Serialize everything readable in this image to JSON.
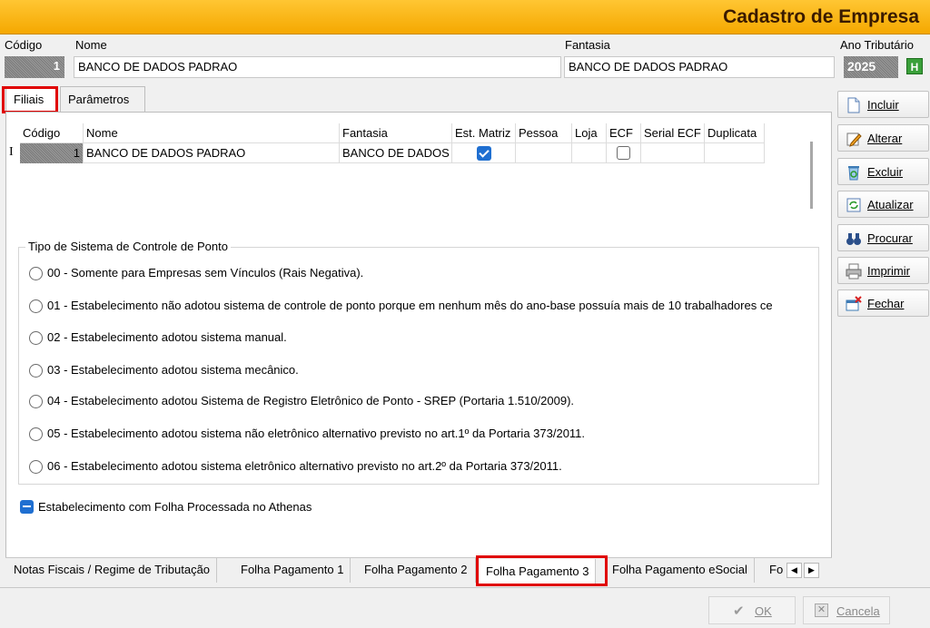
{
  "window": {
    "title": "Cadastro de Empresa"
  },
  "header": {
    "codigo_label": "Código",
    "codigo_value": "1",
    "nome_label": "Nome",
    "nome_value": "BANCO DE DADOS PADRAO",
    "fantasia_label": "Fantasia",
    "fantasia_value": "BANCO DE DADOS PADRAO",
    "ano_label": "Ano Tributário",
    "ano_value": "2025",
    "ano_button": "H"
  },
  "top_tabs": [
    {
      "label": "Filiais",
      "selected": true
    },
    {
      "label": "Parâmetros",
      "selected": false
    }
  ],
  "grid": {
    "columns": [
      "Código",
      "Nome",
      "Fantasia",
      "Est. Matriz",
      "Pessoa",
      "Loja",
      "ECF",
      "Serial ECF",
      "Duplicata"
    ],
    "rows": [
      {
        "codigo": "1",
        "nome": "BANCO DE DADOS PADRAO",
        "fantasia": "BANCO DE DADOS",
        "est_matriz": true,
        "pessoa": "",
        "loja": "",
        "ecf": false,
        "serial_ecf": "",
        "duplicata": ""
      }
    ],
    "row_indicator": "I"
  },
  "ponto": {
    "group_label": "Tipo de Sistema de Controle de Ponto",
    "options": [
      "00 - Somente para Empresas sem Vínculos (Rais Negativa).",
      "01 - Estabelecimento não adotou sistema de controle de ponto porque em nenhum mês do ano-base possuía mais de 10 trabalhadores ce",
      "02 - Estabelecimento adotou sistema manual.",
      "03 - Estabelecimento adotou sistema mecânico.",
      "04 - Estabelecimento adotou Sistema de Registro Eletrônico de Ponto - SREP (Portaria 1.510/2009).",
      "05 - Estabelecimento adotou sistema não eletrônico alternativo previsto no art.1º da Portaria 373/2011.",
      "06 - Estabelecimento adotou sistema eletrônico alternativo previsto no art.2º da Portaria 373/2011."
    ]
  },
  "folha_checkbox": {
    "label": "Estabelecimento com Folha Processada no Athenas",
    "checked": true
  },
  "bottom_tabs": [
    {
      "label": "Notas Fiscais / Regime de Tributação",
      "selected": false
    },
    {
      "label": "Folha Pagamento 1",
      "selected": false
    },
    {
      "label": "Folha Pagamento 2",
      "selected": false
    },
    {
      "label": "Folha Pagamento 3",
      "selected": true
    },
    {
      "label": "Folha Pagamento eSocial",
      "selected": false
    },
    {
      "label": "Fo",
      "selected": false
    }
  ],
  "side_buttons": [
    {
      "label": "Incluir",
      "icon": "document-new-icon"
    },
    {
      "label": "Alterar",
      "icon": "pencil-icon"
    },
    {
      "label": "Excluir",
      "icon": "recycle-bin-icon"
    },
    {
      "label": "Atualizar",
      "icon": "refresh-icon"
    },
    {
      "label": "Procurar",
      "icon": "binoculars-icon"
    },
    {
      "label": "Imprimir",
      "icon": "printer-icon"
    },
    {
      "label": "Fechar",
      "icon": "close-window-icon"
    }
  ],
  "footer": {
    "ok_label": "OK",
    "cancel_label": "Cancela"
  },
  "colors": {
    "titlebar": "#f5a800",
    "highlight": "#e00000",
    "check": "#1f6fd1"
  }
}
